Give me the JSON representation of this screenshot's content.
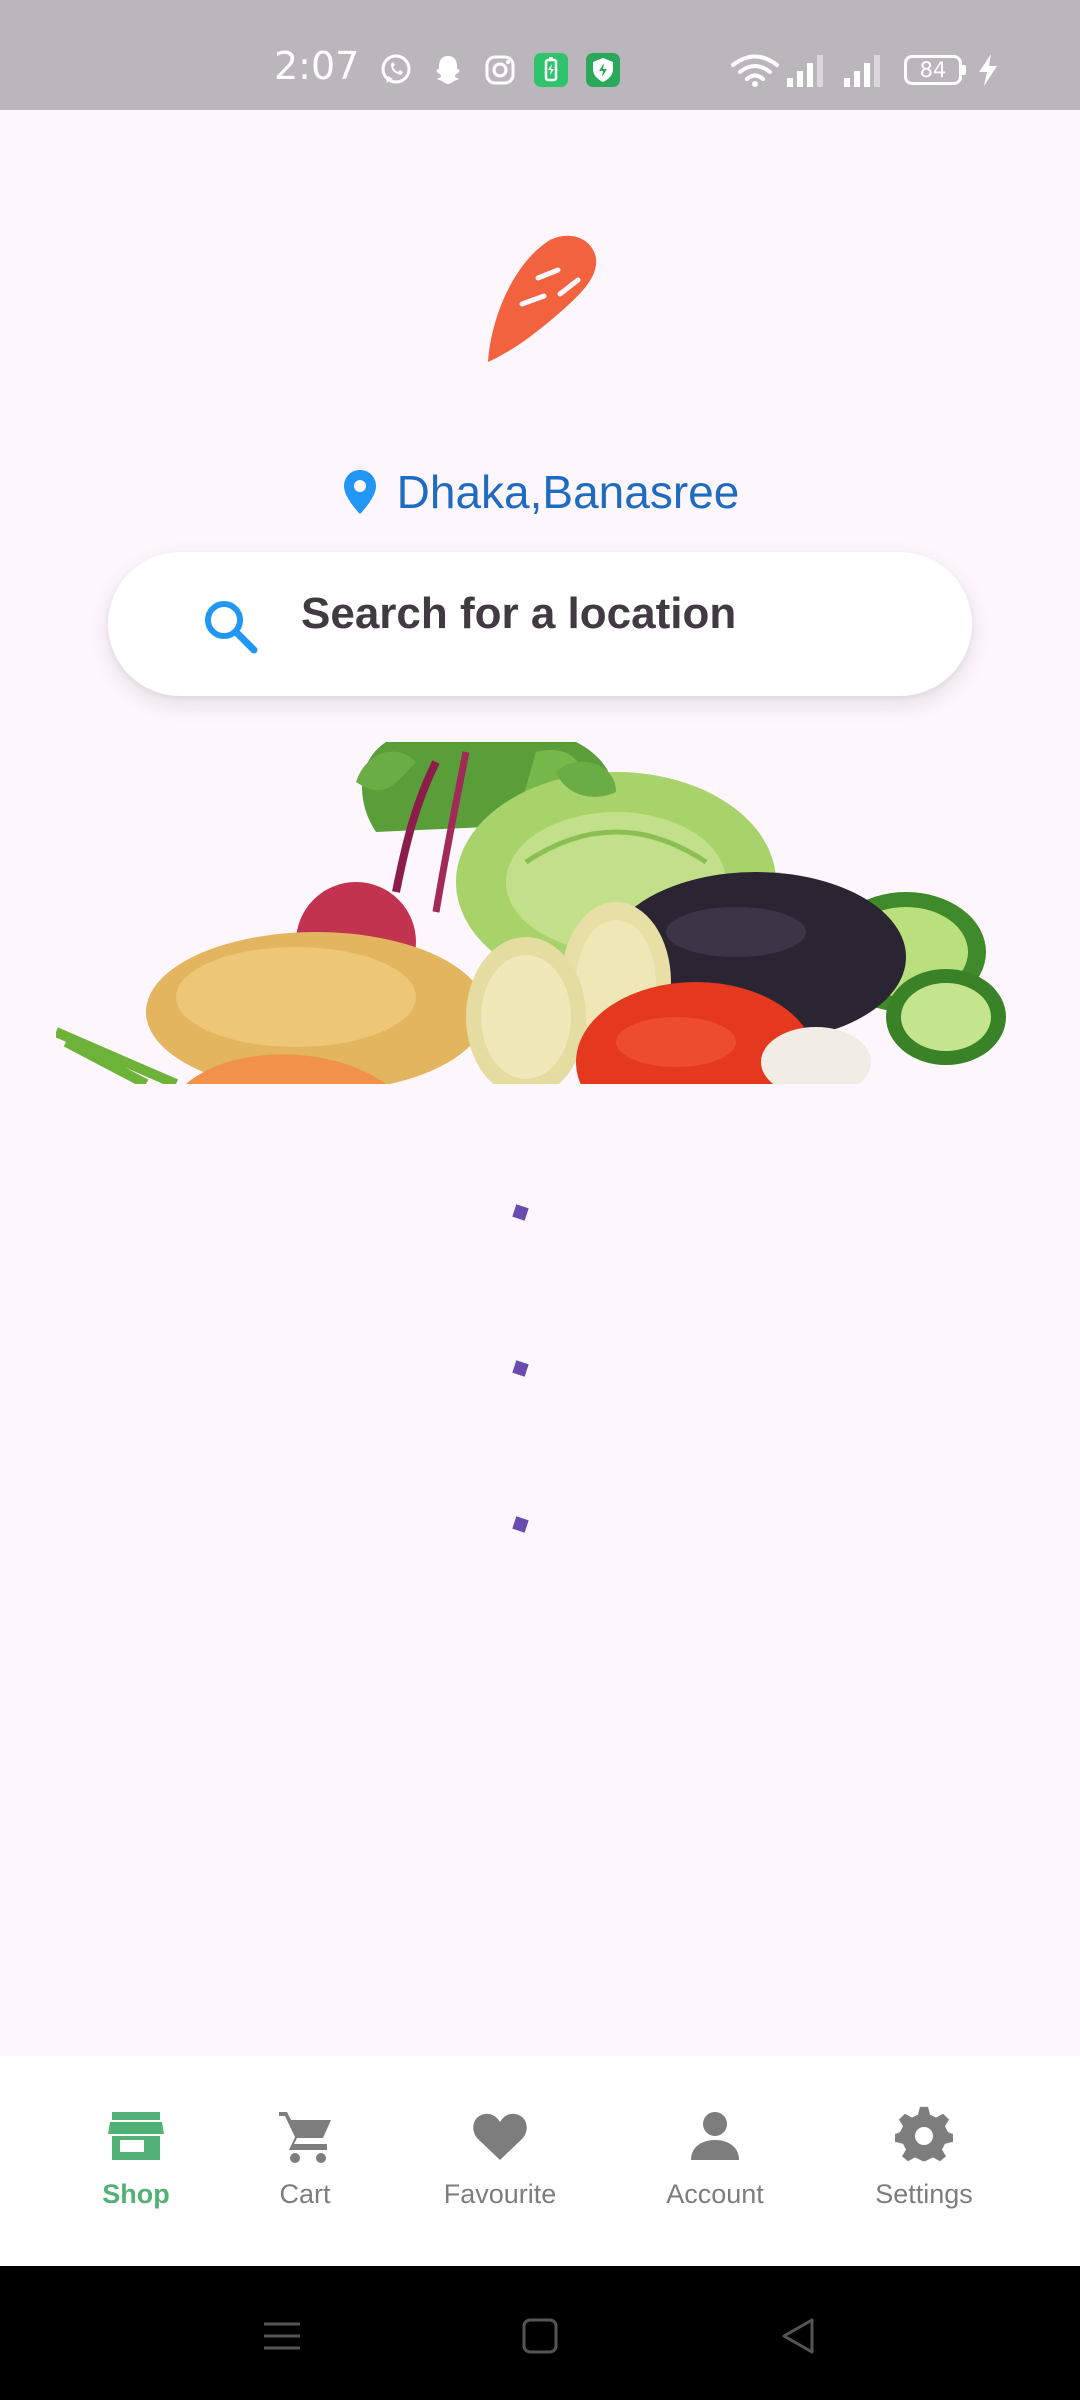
{
  "status_bar": {
    "time": "2:07",
    "battery": "84",
    "left_icons": [
      "whatsapp-icon",
      "snapchat-icon",
      "instagram-icon",
      "battery-app-icon",
      "shield-app-icon"
    ],
    "right_icons": [
      "wifi-icon",
      "signal-icon",
      "signal-icon",
      "charging-icon"
    ]
  },
  "header": {
    "logo": "carrot-logo",
    "location": "Dhaka,Banasree"
  },
  "search": {
    "placeholder": "Search for a location"
  },
  "banner": {
    "image": "vegetables-banner"
  },
  "bottom_nav": {
    "items": [
      {
        "label": "Shop",
        "icon": "store-icon",
        "active": true
      },
      {
        "label": "Cart",
        "icon": "cart-icon",
        "active": false
      },
      {
        "label": "Favourite",
        "icon": "heart-icon",
        "active": false
      },
      {
        "label": "Account",
        "icon": "person-icon",
        "active": false
      },
      {
        "label": "Settings",
        "icon": "gear-icon",
        "active": false
      }
    ]
  },
  "system_nav": [
    "menu-icon",
    "home-icon",
    "back-icon"
  ],
  "colors": {
    "accent_green": "#53b175",
    "location_blue": "#1f6bc2",
    "search_icon_blue": "#2196f3",
    "logo_orange": "#f3623f",
    "loader_purple": "#6a4caf",
    "background": "#fdf6fc",
    "status_bar": "#bbb6bc"
  }
}
